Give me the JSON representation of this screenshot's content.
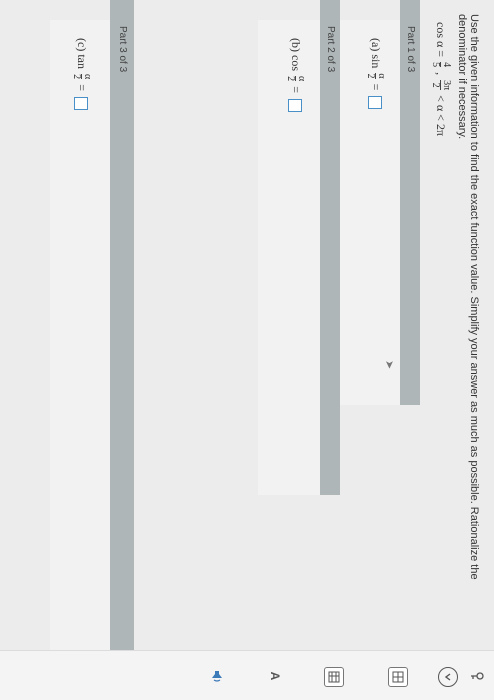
{
  "instructions": "Use the given information to find the exact function value. Simplify your answer as much as possible. Rationalize the denominator if necessary.",
  "given": {
    "lhs": "cos α =",
    "frac1": {
      "num": "4",
      "den": "5"
    },
    "sep": ",",
    "frac2": {
      "num": "3π",
      "den": "2"
    },
    "rest": "< α < 2π"
  },
  "parts": [
    {
      "label": "Part 1 of 3",
      "prefix": "(a)",
      "func": "sin",
      "num": "α",
      "den": "2",
      "eq": "="
    },
    {
      "label": "Part 2 of 3",
      "prefix": "(b)",
      "func": "cos",
      "num": "α",
      "den": "2",
      "eq": "="
    },
    {
      "label": "Part 3 of 3",
      "prefix": "(c)",
      "func": "tan",
      "num": "α",
      "den": "2",
      "eq": "="
    }
  ],
  "colors": {
    "partbar": "#aeb6b8",
    "answer_box_border": "#4a90c8",
    "panel": "#f2f2f2"
  },
  "icons": [
    "key-icon",
    "chevron-icon",
    "grid-icon",
    "table-icon",
    "font-size-icon",
    "speaker-icon",
    "cursor-icon"
  ]
}
